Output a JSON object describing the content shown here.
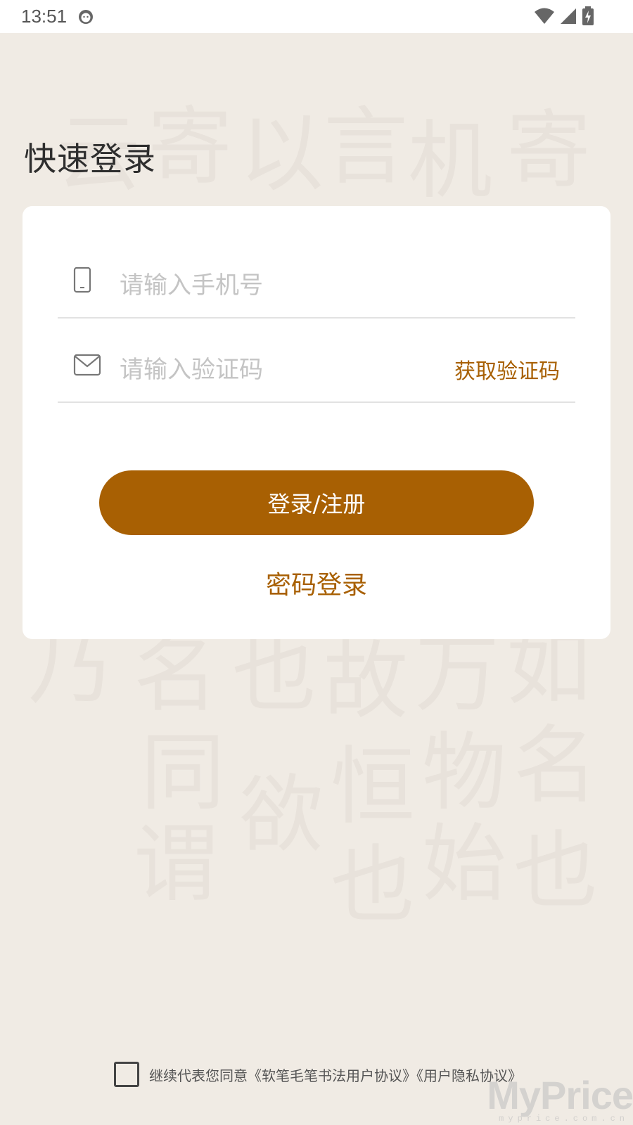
{
  "status_bar": {
    "time": "13:51"
  },
  "page": {
    "title": "快速登录"
  },
  "form": {
    "phone_placeholder": "请输入手机号",
    "code_placeholder": "请输入验证码",
    "get_code_label": "获取验证码",
    "login_button_label": "登录/注册",
    "password_login_label": "密码登录"
  },
  "agreement": {
    "text": "继续代表您同意《软笔毛笔书法用户协议》《用户隐私协议》",
    "checked": false
  },
  "watermark": {
    "main": "MyPrice",
    "sub": "myprice.com.cn"
  },
  "colors": {
    "accent": "#a86003",
    "background": "#f0ebe4",
    "card": "#ffffff"
  }
}
